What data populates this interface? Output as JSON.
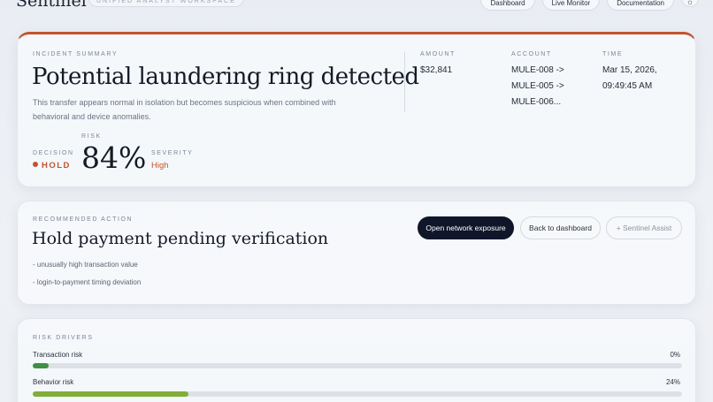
{
  "header": {
    "brand": "Sentinel",
    "subtitle": "UNIFIED ANALYST WORKSPACE",
    "nav": [
      "Dashboard",
      "Live Monitor",
      "Documentation"
    ],
    "theme_icon": "sun-icon"
  },
  "incident": {
    "eyebrow": "INCIDENT SUMMARY",
    "title": "Potential laundering ring detected",
    "description": "This transfer appears normal in isolation but becomes suspicious when combined with behavioral and device anomalies.",
    "decision_label": "DECISION",
    "decision_value": "HOLD",
    "risk_label": "RISK",
    "risk_value": "84%",
    "severity_label": "SEVERITY",
    "severity_value": "High",
    "amount_label": "AMOUNT",
    "amount_value": "$32,841",
    "account_label": "ACCOUNT",
    "account_lines": [
      "MULE-008 ->",
      "MULE-005 ->",
      "MULE-006..."
    ],
    "time_label": "TIME",
    "time_lines": [
      "Mar 15, 2026,",
      "09:49:45 AM"
    ],
    "accent_color": "#c2542d"
  },
  "recommended": {
    "eyebrow": "RECOMMENDED ACTION",
    "title": "Hold payment pending verification",
    "bullets": [
      "- unusually high transaction value",
      "- login-to-payment timing deviation"
    ],
    "buttons": {
      "primary": "Open network exposure",
      "secondary": "Back to dashboard",
      "assist": "+ Sentinel Assist"
    }
  },
  "drivers": {
    "eyebrow": "RISK DRIVERS",
    "items": [
      {
        "label": "Transaction risk",
        "percent_text": "0%",
        "fill_fraction": 0.025,
        "color": "#3f8f45"
      },
      {
        "label": "Behavior risk",
        "percent_text": "24%",
        "fill_fraction": 0.24,
        "color": "#7fae3a"
      }
    ]
  }
}
